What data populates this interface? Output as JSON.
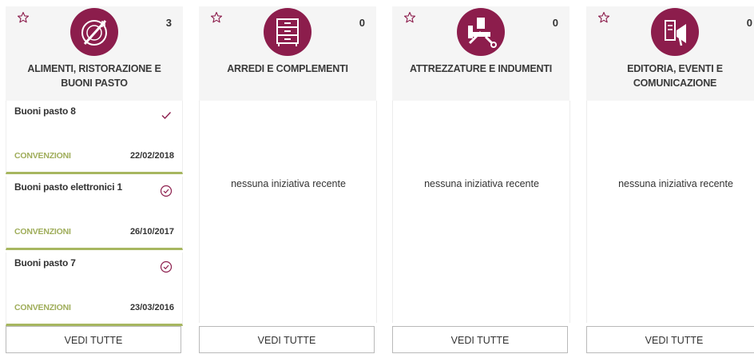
{
  "colors": {
    "accent": "#8c1d4c",
    "convenzioni": "#9fad5a",
    "header_bg": "#f5f5f5"
  },
  "cards": [
    {
      "title": "ALIMENTI, RISTORAZIONE E BUONI PASTO",
      "count": "3",
      "icon": "food-plate-icon",
      "button": "VEDI TUTTE",
      "items": [
        {
          "title": "Buoni pasto 8",
          "tag": "CONVENZIONI",
          "date": "22/02/2018",
          "status_icon": "check-icon"
        },
        {
          "title": "Buoni pasto elettronici 1",
          "tag": "CONVENZIONI",
          "date": "26/10/2017",
          "status_icon": "circle-check-icon"
        },
        {
          "title": "Buoni pasto 7",
          "tag": "CONVENZIONI",
          "date": "23/03/2016",
          "status_icon": "circle-check-icon"
        }
      ]
    },
    {
      "title": "ARREDI E COMPLEMENTI",
      "count": "0",
      "icon": "cabinet-icon",
      "empty_text": "nessuna iniziativa recente",
      "button": "VEDI TUTTE"
    },
    {
      "title": "ATTREZZATURE E INDUMENTI",
      "count": "0",
      "icon": "tools-icon",
      "empty_text": "nessuna iniziativa recente",
      "button": "VEDI TUTTE"
    },
    {
      "title": "EDITORIA, EVENTI E COMUNICAZIONE",
      "count": "0",
      "icon": "megaphone-icon",
      "empty_text": "nessuna iniziativa recente",
      "button": "VEDI TUTTE"
    }
  ]
}
